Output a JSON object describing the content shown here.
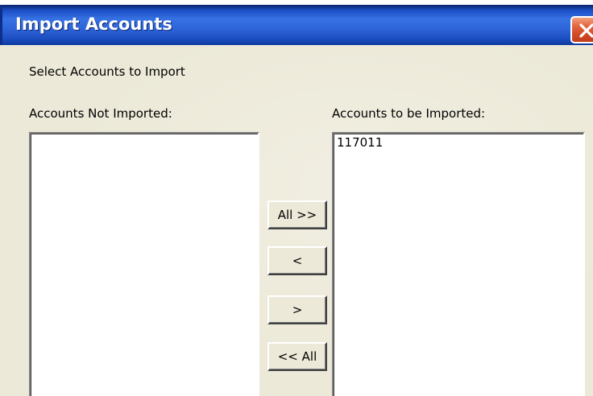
{
  "window": {
    "title": "Import Accounts",
    "close_icon": "close-icon"
  },
  "instructions": "Select Accounts to Import",
  "left_list": {
    "label": "Accounts Not Imported:",
    "items": []
  },
  "right_list": {
    "label": "Accounts to be Imported:",
    "items": [
      "117011"
    ]
  },
  "buttons": {
    "add_all": "All >>",
    "remove_one": "<",
    "add_one": ">",
    "remove_all": "<< All"
  },
  "colors": {
    "titlebar": "#2d62d6",
    "close_button": "#d9542e",
    "dialog_background": "#ece9d8"
  }
}
